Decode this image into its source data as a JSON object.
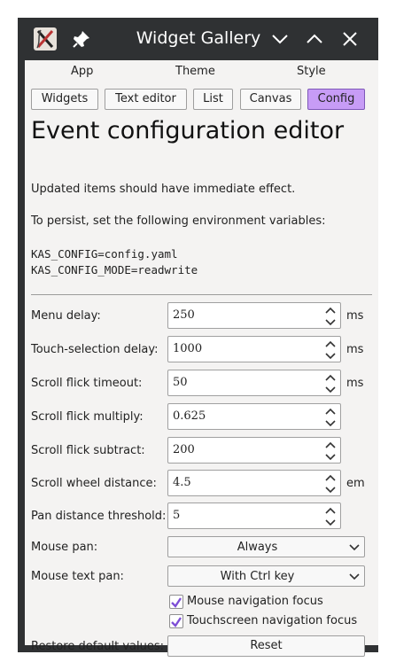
{
  "window": {
    "title": "Widget Gallery",
    "title_bar_bg": "#2f3133",
    "accent": "#c79cf6"
  },
  "menu": {
    "items": [
      "App",
      "Theme",
      "Style"
    ]
  },
  "tabs": [
    {
      "label": "Widgets",
      "active": false
    },
    {
      "label": "Text editor",
      "active": false
    },
    {
      "label": "List",
      "active": false
    },
    {
      "label": "Canvas",
      "active": false
    },
    {
      "label": "Config",
      "active": true
    }
  ],
  "page": {
    "heading": "Event configuration editor",
    "intro": "Updated items should have immediate effect.",
    "persist": "To persist, set the following environment variables:",
    "env1": "KAS_CONFIG=config.yaml",
    "env2": "KAS_CONFIG_MODE=readwrite"
  },
  "fields": [
    {
      "label": "Menu delay:",
      "value": "250",
      "unit": "ms"
    },
    {
      "label": "Touch-selection delay:",
      "value": "1000",
      "unit": "ms"
    },
    {
      "label": "Scroll flick timeout:",
      "value": "50",
      "unit": "ms"
    },
    {
      "label": "Scroll flick multiply:",
      "value": "0.625",
      "unit": ""
    },
    {
      "label": "Scroll flick subtract:",
      "value": "200",
      "unit": ""
    },
    {
      "label": "Scroll wheel distance:",
      "value": "4.5",
      "unit": "em"
    },
    {
      "label": "Pan distance threshold:",
      "value": "5",
      "unit": ""
    }
  ],
  "selects": [
    {
      "label": "Mouse pan:",
      "value": "Always"
    },
    {
      "label": "Mouse text pan:",
      "value": "With Ctrl key"
    }
  ],
  "checks": [
    {
      "label": "Mouse navigation focus",
      "checked": true
    },
    {
      "label": "Touchscreen navigation focus",
      "checked": true
    }
  ],
  "restore": {
    "label": "Restore default values:",
    "button": "Reset"
  }
}
